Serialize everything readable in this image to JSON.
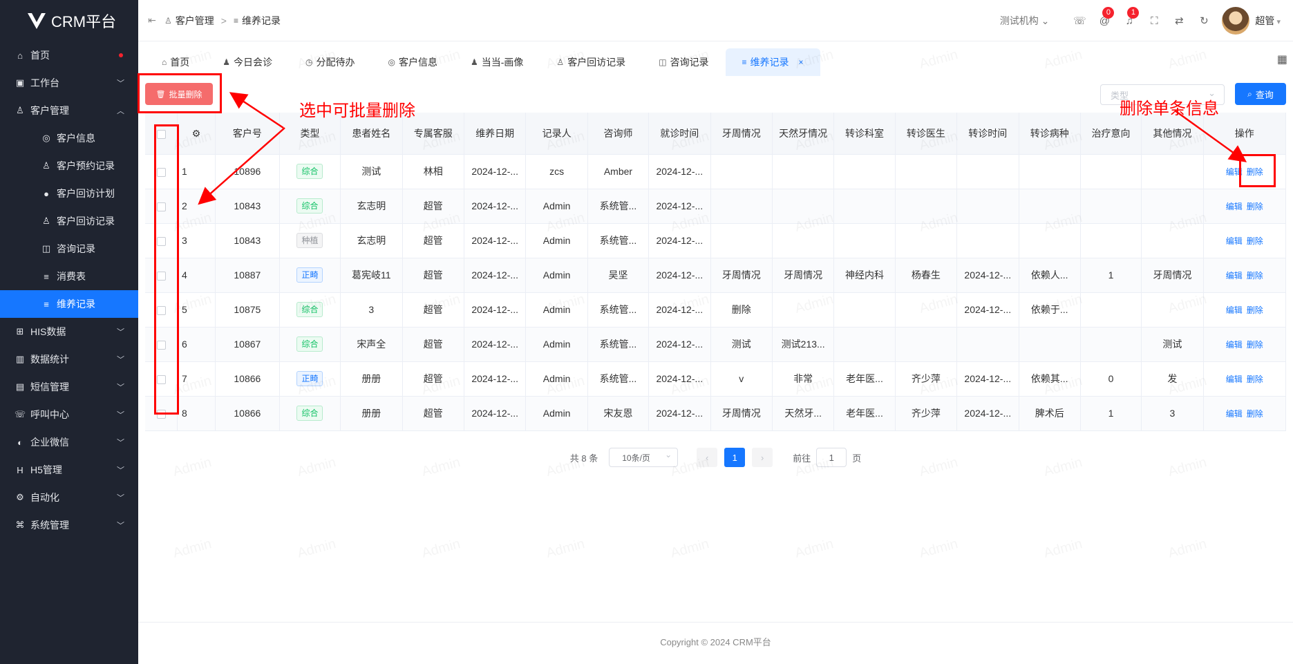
{
  "app": {
    "logo_text": "CRM平台"
  },
  "sidebar": {
    "items": [
      {
        "label": "首页",
        "icon": "home-icon",
        "glyph": "⌂",
        "level": 0,
        "dot": true
      },
      {
        "label": "工作台",
        "icon": "briefcase-icon",
        "glyph": "▣",
        "level": 0,
        "chevron": "down"
      },
      {
        "label": "客户管理",
        "icon": "user-icon",
        "glyph": "♙",
        "level": 0,
        "chevron": "up"
      },
      {
        "label": "客户信息",
        "icon": "shield-user-icon",
        "glyph": "◎",
        "level": 1
      },
      {
        "label": "客户预约记录",
        "icon": "user-clock-icon",
        "glyph": "♙",
        "level": 1
      },
      {
        "label": "客户回访计划",
        "icon": "user-solid-icon",
        "glyph": "●",
        "level": 1
      },
      {
        "label": "客户回访记录",
        "icon": "user-outline-icon",
        "glyph": "♙",
        "level": 1
      },
      {
        "label": "咨询记录",
        "icon": "chat-icon",
        "glyph": "◫",
        "level": 1
      },
      {
        "label": "消费表",
        "icon": "list-icon",
        "glyph": "≡",
        "level": 1
      },
      {
        "label": "维养记录",
        "icon": "list-alt-icon",
        "glyph": "≡",
        "level": 1,
        "active": true
      },
      {
        "label": "HIS数据",
        "icon": "hospital-icon",
        "glyph": "⊞",
        "level": 0,
        "chevron": "down"
      },
      {
        "label": "数据统计",
        "icon": "bar-chart-icon",
        "glyph": "▥",
        "level": 0,
        "chevron": "down"
      },
      {
        "label": "短信管理",
        "icon": "message-icon",
        "glyph": "▤",
        "level": 0,
        "chevron": "down"
      },
      {
        "label": "呼叫中心",
        "icon": "phone-icon",
        "glyph": "☏",
        "level": 0,
        "chevron": "down"
      },
      {
        "label": "企业微信",
        "icon": "wechat-icon",
        "glyph": "◐",
        "level": 0,
        "chevron": "down"
      },
      {
        "label": "H5管理",
        "icon": "h5-icon",
        "glyph": "H",
        "level": 0,
        "chevron": "down"
      },
      {
        "label": "自动化",
        "icon": "automation-icon",
        "glyph": "⚙",
        "level": 0,
        "chevron": "down"
      },
      {
        "label": "系统管理",
        "icon": "command-icon",
        "glyph": "⌘",
        "level": 0,
        "chevron": "down"
      }
    ]
  },
  "header": {
    "breadcrumb": [
      "客户管理",
      "维养记录"
    ],
    "org": "测试机构",
    "notify_badges": [
      "0",
      "1"
    ],
    "user": "超管"
  },
  "tabs": [
    {
      "label": "首页",
      "icon": "home-icon",
      "glyph": "⌂"
    },
    {
      "label": "今日会诊",
      "icon": "user-group-icon",
      "glyph": "♟"
    },
    {
      "label": "分配待办",
      "icon": "alarm-icon",
      "glyph": "◷"
    },
    {
      "label": "客户信息",
      "icon": "shield-user-icon",
      "glyph": "◎"
    },
    {
      "label": "当当-画像",
      "icon": "user-solid-icon",
      "glyph": "♟"
    },
    {
      "label": "客户回访记录",
      "icon": "user-outline-icon",
      "glyph": "♙"
    },
    {
      "label": "咨询记录",
      "icon": "chat-icon",
      "glyph": "◫"
    },
    {
      "label": "维养记录",
      "icon": "list-alt-icon",
      "glyph": "≡",
      "active": true
    }
  ],
  "toolbar": {
    "batch_delete": "批量删除",
    "type_placeholder": "类型",
    "query": "查询"
  },
  "table": {
    "columns": [
      "",
      "",
      "客户号",
      "类型",
      "患者姓名",
      "专属客服",
      "维养日期",
      "记录人",
      "咨询师",
      "就诊时间",
      "牙周情况",
      "天然牙情况",
      "转诊科室",
      "转诊医生",
      "转诊时间",
      "转诊病种",
      "治疗意向",
      "其他情况",
      "操作"
    ],
    "edit_label": "编辑",
    "delete_label": "删除",
    "rows": [
      [
        "1",
        "10896",
        "综合",
        "测试",
        "林相",
        "2024-12-...",
        "zcs",
        "Amber",
        "2024-12-...",
        "",
        "",
        "",
        "",
        "",
        "",
        "",
        ""
      ],
      [
        "2",
        "10843",
        "综合",
        "玄志明",
        "超管",
        "2024-12-...",
        "Admin",
        "系统管...",
        "2024-12-...",
        "",
        "",
        "",
        "",
        "",
        "",
        "",
        ""
      ],
      [
        "3",
        "10843",
        "种植",
        "玄志明",
        "超管",
        "2024-12-...",
        "Admin",
        "系统管...",
        "2024-12-...",
        "",
        "",
        "",
        "",
        "",
        "",
        "",
        ""
      ],
      [
        "4",
        "10887",
        "正畸",
        "葛宪岐11",
        "超管",
        "2024-12-...",
        "Admin",
        "吴坚",
        "2024-12-...",
        "牙周情况",
        "牙周情况",
        "神经内科",
        "杨春生",
        "2024-12-...",
        "依赖人...",
        "1",
        "牙周情况"
      ],
      [
        "5",
        "10875",
        "综合",
        "3",
        "超管",
        "2024-12-...",
        "Admin",
        "系统管...",
        "2024-12-...",
        "删除",
        "",
        "",
        "",
        "2024-12-...",
        "依赖于...",
        "",
        ""
      ],
      [
        "6",
        "10867",
        "综合",
        "宋声全",
        "超管",
        "2024-12-...",
        "Admin",
        "系统管...",
        "2024-12-...",
        "测试",
        "测试213...",
        "",
        "",
        "",
        "",
        "",
        "测试"
      ],
      [
        "7",
        "10866",
        "正畸",
        "册册",
        "超管",
        "2024-12-...",
        "Admin",
        "系统管...",
        "2024-12-...",
        "v",
        "非常",
        "老年医...",
        "齐少萍",
        "2024-12-...",
        "依赖其...",
        "0",
        "发"
      ],
      [
        "8",
        "10866",
        "综合",
        "册册",
        "超管",
        "2024-12-...",
        "Admin",
        "宋友恩",
        "2024-12-...",
        "牙周情况",
        "天然牙...",
        "老年医...",
        "齐少萍",
        "2024-12-...",
        "脾术后",
        "1",
        "3"
      ]
    ]
  },
  "pagination": {
    "total": "共 8 条",
    "page_size": "10条/页",
    "current": "1",
    "goto_prefix": "前往",
    "goto_value": "1",
    "goto_suffix": "页"
  },
  "footer": {
    "copyright": "Copyright © 2024 CRM平台"
  },
  "watermark": "Admin",
  "annotations": {
    "batch_note": "选中可批量删除",
    "single_note": "删除单条信息",
    "color": "#ff0000"
  },
  "colors": {
    "primary": "#1677ff",
    "danger": "#f56c6c",
    "sidebar_bg": "#1f2430"
  }
}
